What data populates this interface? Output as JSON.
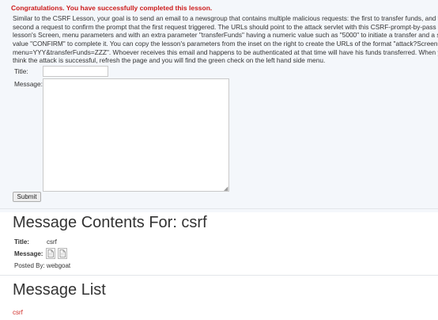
{
  "status": {
    "success_message": "Congratulations. You have successfully completed this lesson."
  },
  "instructions": {
    "lines": [
      "Similar to the CSRF Lesson, your goal is to send an email to a newsgroup that contains multiple malicious requests: the first to transfer funds, and the",
      "second a request to confirm the prompt that the first request triggered. The URLs should point to the attack servlet with this CSRF-prompt-by-pass",
      "lesson's Screen, menu parameters and with an extra parameter \"transferFunds\" having a numeric value such as \"5000\" to initiate a transfer and a string",
      "value \"CONFIRM\" to complete it. You can copy the lesson's parameters from the inset on the right to create the URLs of the format \"attack?Screen=XX",
      "menu=YYY&transferFunds=ZZZ\". Whoever receives this email and happens to be authenticated at that time will have his funds transferred. When you",
      "think the attack is successful, refresh the page and you will find the green check on the left hand side menu."
    ]
  },
  "form": {
    "title_label": "Title:",
    "title_value": "",
    "message_label": "Message:",
    "message_value": "",
    "submit_label": "Submit"
  },
  "contents": {
    "heading": "Message Contents For: csrf",
    "title_label": "Title:",
    "title_value": "csrf",
    "message_label": "Message:",
    "posted_by": "Posted By: webgoat"
  },
  "list": {
    "heading": "Message List",
    "items": [
      "csrf"
    ]
  },
  "colors": {
    "success": "#cc1a1a",
    "link": "#d0302b",
    "panel_bg": "#f4f7fb"
  },
  "icons": {
    "message_icon_1": "broken-image-icon",
    "message_icon_2": "broken-image-icon"
  }
}
